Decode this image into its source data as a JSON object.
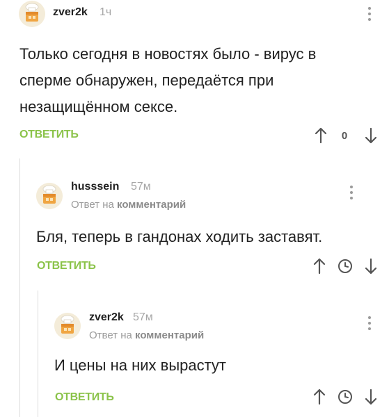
{
  "comments": [
    {
      "author": "zver2k",
      "time": "1ч",
      "text": "Только сегодня в новостях было - вирус в сперме обнаружен, передаётся при незащищённом сексе.",
      "reply_label": "ОТВЕТИТЬ",
      "rating": "0"
    },
    {
      "author": "husssein",
      "time": "57м",
      "reply_to_prefix": "Ответ на",
      "reply_to_link": "комментарий",
      "text": "Бля, теперь в гандонах ходить заставят.",
      "reply_label": "ОТВЕТИТЬ"
    },
    {
      "author": "zver2k",
      "time": "57м",
      "reply_to_prefix": "Ответ на",
      "reply_to_link": "комментарий",
      "text": "И цены на них вырастут",
      "reply_label": "ОТВЕТИТЬ"
    }
  ],
  "colors": {
    "accent": "#8bc34a",
    "text": "#222222",
    "muted": "#a6a6a6",
    "thread_line": "#dcdcdc"
  },
  "icons": [
    "avatar-icon",
    "more-icon",
    "upvote-icon",
    "downvote-icon",
    "clock-icon"
  ]
}
